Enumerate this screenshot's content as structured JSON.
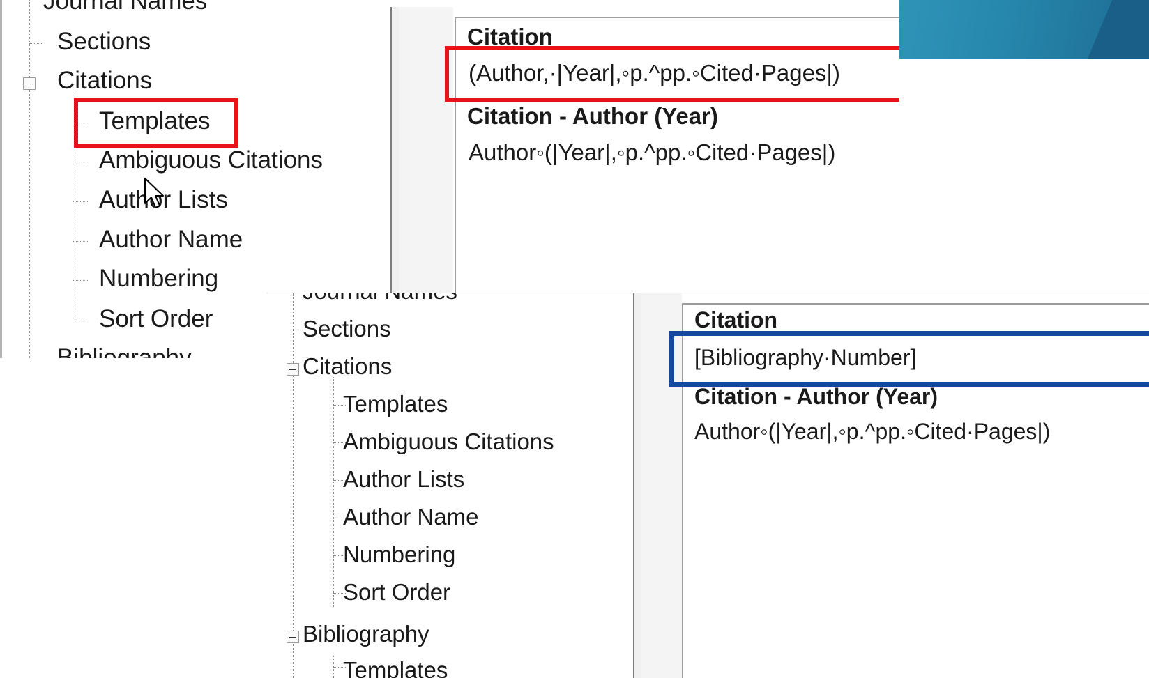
{
  "colors": {
    "highlight_red": "#e8121a",
    "highlight_blue": "#1347a0",
    "slide_accent": "#2a8db0"
  },
  "screenshot_top": {
    "tree": {
      "partial_top": "Journal Names",
      "sections": "Sections",
      "citations": "Citations",
      "children": [
        "Templates",
        "Ambiguous Citations",
        "Author Lists",
        "Author Name",
        "Numbering",
        "Sort Order"
      ],
      "partial_bottom": "Bibliography"
    },
    "fields": [
      {
        "title": "Citation",
        "value": "(Author,·|Year|,◦p.^pp.◦Cited·Pages|)"
      },
      {
        "title": "Citation - Author (Year)",
        "value": "Author◦(|Year|,◦p.^pp.◦Cited·Pages|)"
      }
    ],
    "cursor_icon": "mouse-pointer-icon"
  },
  "screenshot_bottom": {
    "tree": {
      "partial_top": "Journal Names",
      "sections": "Sections",
      "citations": "Citations",
      "children": [
        "Templates",
        "Ambiguous Citations",
        "Author Lists",
        "Author Name",
        "Numbering",
        "Sort Order"
      ],
      "bibliography": "Bibliography",
      "partial_bottom": "Templates"
    },
    "fields": [
      {
        "title": "Citation",
        "value": "[Bibliography·Number]"
      },
      {
        "title": "Citation - Author (Year)",
        "value": "Author◦(|Year|,◦p.^pp.◦Cited·Pages|)"
      }
    ]
  }
}
